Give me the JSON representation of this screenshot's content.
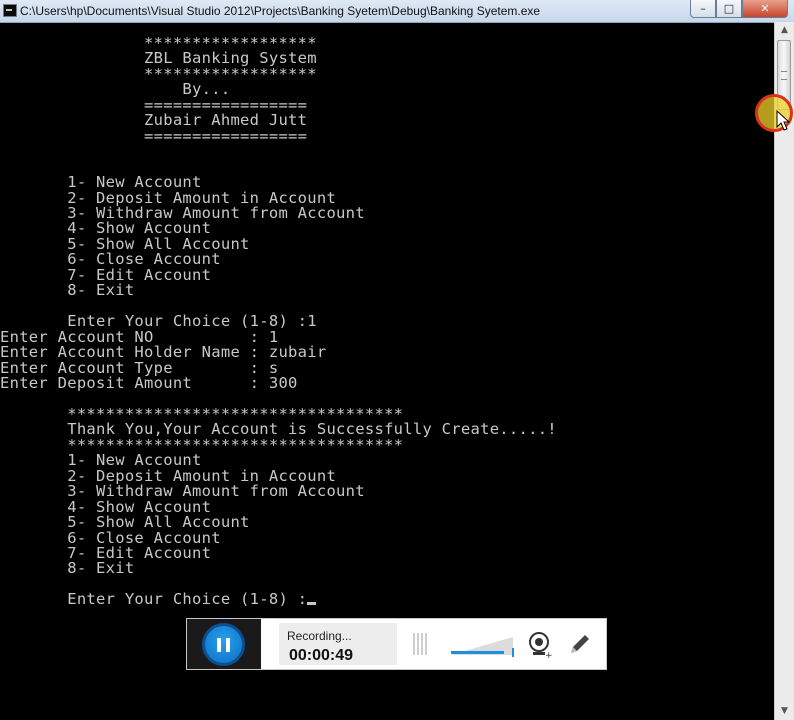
{
  "window": {
    "title": "C:\\Users\\hp\\Documents\\Visual Studio 2012\\Projects\\Banking Syetem\\Debug\\Banking Syetem.exe",
    "minimize_glyph": "–",
    "maximize_glyph": "□",
    "close_glyph": "✕"
  },
  "console": {
    "lines": [
      "               ******************",
      "               ZBL Banking System",
      "               ******************",
      "                   By...",
      "               =================",
      "               Zubair Ahmed Jutt",
      "               =================",
      "",
      "",
      "       1- New Account",
      "       2- Deposit Amount in Account",
      "       3- Withdraw Amount from Account",
      "       4- Show Account",
      "       5- Show All Account",
      "       6- Close Account",
      "       7- Edit Account",
      "       8- Exit",
      "",
      "       Enter Your Choice (1-8) :1",
      "Enter Account NO          : 1",
      "Enter Account Holder Name : zubair",
      "Enter Account Type        : s",
      "Enter Deposit Amount      : 300",
      "",
      "       ***********************************",
      "       Thank You,Your Account is Successfully Create.....!",
      "       ***********************************",
      "       1- New Account",
      "       2- Deposit Amount in Account",
      "       3- Withdraw Amount from Account",
      "       4- Show Account",
      "       5- Show All Account",
      "       6- Close Account",
      "       7- Edit Account",
      "       8- Exit",
      "",
      "       Enter Your Choice (1-8) :"
    ]
  },
  "recorder": {
    "status": "Recording...",
    "time": "00:00:49",
    "volume_level": 0.85
  },
  "scrollbar": {
    "up_glyph": "▲",
    "down_glyph": "▼"
  },
  "colors": {
    "console_bg": "#000000",
    "console_text": "#c8c8c8",
    "accent": "#1e8ee0"
  }
}
